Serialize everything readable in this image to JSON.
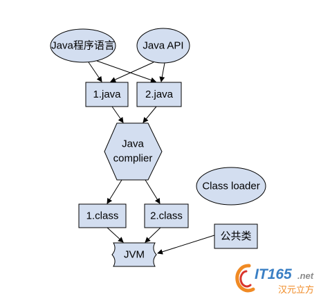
{
  "colors": {
    "node_fill": "#d3def0",
    "node_stroke": "#000000",
    "edge": "#000000",
    "watermark_blue": "#3a7fc4",
    "watermark_orange": "#f08a24",
    "watermark_red": "#d9342b",
    "watermark_gray": "#8a8a8a"
  },
  "nodes": {
    "java_language": {
      "label": "Java程序语言"
    },
    "java_api": {
      "label": "Java API"
    },
    "java1": {
      "label": "1.java"
    },
    "java2": {
      "label": "2.java"
    },
    "compiler": {
      "line1": "Java",
      "line2": "complier"
    },
    "class_loader": {
      "label": "Class loader"
    },
    "class1": {
      "label": "1.class"
    },
    "class2": {
      "label": "2.class"
    },
    "public_class": {
      "label": "公共类"
    },
    "jvm": {
      "label": "JVM"
    }
  },
  "edges": [
    {
      "from": "java_language",
      "to": "java1"
    },
    {
      "from": "java_language",
      "to": "java2"
    },
    {
      "from": "java_api",
      "to": "java1"
    },
    {
      "from": "java_api",
      "to": "java2"
    },
    {
      "from": "java1",
      "to": "compiler"
    },
    {
      "from": "java2",
      "to": "compiler"
    },
    {
      "from": "compiler",
      "to": "class1"
    },
    {
      "from": "compiler",
      "to": "class2"
    },
    {
      "from": "class1",
      "to": "jvm"
    },
    {
      "from": "class2",
      "to": "jvm"
    },
    {
      "from": "public_class",
      "to": "jvm"
    }
  ],
  "watermark": {
    "brand": "IT165",
    "suffix": ".net",
    "tagline": "汉元立方"
  }
}
